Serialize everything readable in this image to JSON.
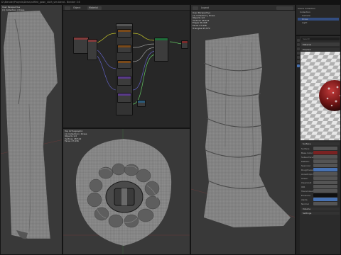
{
  "window": {
    "title": "D:\\Blender\\Projects\\Dress\\ruffled_gown_cloth_sim.blend - Blender 3.6"
  },
  "viewport_front": {
    "view_label": "User Perspective",
    "collection_label": "(1) Collection | Dress"
  },
  "shader_editor": {
    "header_label": "Object",
    "slot_label": "Material"
  },
  "viewport_top": {
    "overlay_lines": [
      "Top Orthographic",
      "(1) Collection | Dress",
      "Objects 1/2",
      "Vertices 48,512",
      "Faces 47,936"
    ]
  },
  "viewport_right": {
    "header_label": "Layout",
    "overlay_lines": [
      "User Perspective",
      "(1) Collection | Dress",
      "Objects 1/2",
      "Vertices 48,512",
      "Edges 96,448",
      "Faces 47,936",
      "Triangles 95,872"
    ]
  },
  "outliner": {
    "rows": [
      "Scene Collection",
      "Collection",
      "Camera",
      "Dress",
      "Light"
    ]
  },
  "properties": {
    "search_placeholder": "Search",
    "material_label": "Material",
    "sections": [
      "Preview",
      "Surface",
      "Volume",
      "Settings"
    ],
    "rows": [
      "Surface",
      "Base Color",
      "Subsurface",
      "Metallic",
      "Specular",
      "Roughness",
      "Anisotropic",
      "Sheen",
      "Clearcoat",
      "IOR",
      "Transmission",
      "Emission",
      "Alpha",
      "Normal"
    ]
  },
  "colors": {
    "accent": "#4772b3",
    "header": "#2e2e2e",
    "viewport": "#393939",
    "node_editor": "#272727"
  }
}
